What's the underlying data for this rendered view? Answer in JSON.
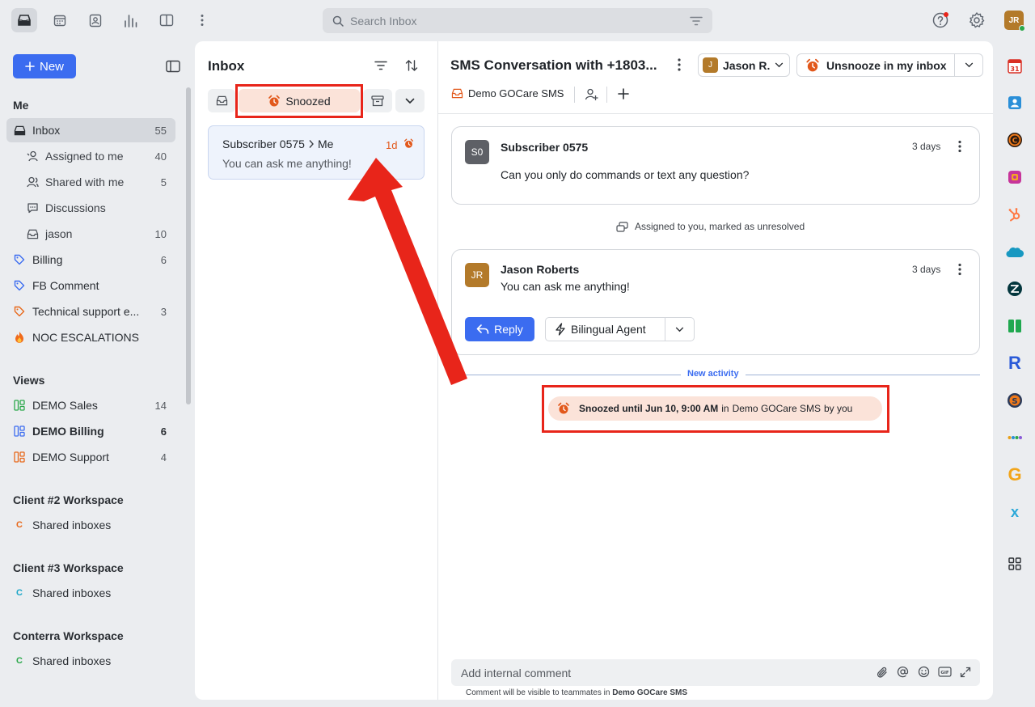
{
  "topbar": {
    "search_placeholder": "Search Inbox",
    "user_initials": "JR",
    "icons": [
      "inbox-icon",
      "calendar-icon",
      "contacts-icon",
      "analytics-icon",
      "split-view-icon",
      "more-icon"
    ]
  },
  "sidebar": {
    "new_label": "New",
    "me_title": "Me",
    "me_items": [
      {
        "label": "Inbox",
        "count": "55"
      },
      {
        "label": "Assigned to me",
        "count": "40"
      },
      {
        "label": "Shared with me",
        "count": "5"
      },
      {
        "label": "Discussions",
        "count": ""
      },
      {
        "label": "jason",
        "count": "10"
      },
      {
        "label": "Billing",
        "count": "6"
      },
      {
        "label": "FB Comment",
        "count": ""
      },
      {
        "label": "Technical support e...",
        "count": "3"
      },
      {
        "label": "NOC ESCALATIONS",
        "count": ""
      }
    ],
    "views_title": "Views",
    "views": [
      {
        "label": "DEMO Sales",
        "count": "14"
      },
      {
        "label": "DEMO Billing",
        "count": "6"
      },
      {
        "label": "DEMO Support",
        "count": "4"
      }
    ],
    "workspaces": [
      {
        "title": "Client #2 Workspace",
        "item": "Shared inboxes",
        "letter": "C",
        "color": "#e8681a"
      },
      {
        "title": "Client #3 Workspace",
        "item": "Shared inboxes",
        "letter": "C",
        "color": "#1aa6c8"
      },
      {
        "title": "Conterra Workspace",
        "item": "Shared inboxes",
        "letter": "C",
        "color": "#2aa84a"
      }
    ]
  },
  "inbox_list": {
    "title": "Inbox",
    "snoozed_label": "Snoozed",
    "item": {
      "sender": "Subscriber 0575",
      "recipient": "Me",
      "time": "1d",
      "preview": "You can ask me anything!"
    }
  },
  "conversation": {
    "title": "SMS Conversation with +1803...",
    "assignee_initial": "J",
    "assignee": "Jason R.",
    "unsnooze_label": "Unsnooze in my inbox",
    "inbox_tag": "Demo GOCare SMS",
    "messages": [
      {
        "initials": "S0",
        "author": "Subscriber 0575",
        "time": "3 days",
        "body": "Can you only do commands or text any question?"
      },
      {
        "initials": "JR",
        "author": "Jason Roberts",
        "time": "3 days",
        "body": "You can ask me anything!"
      }
    ],
    "assigned_event": "Assigned to you, marked as unresolved",
    "reply_label": "Reply",
    "agent_label": "Bilingual Agent",
    "new_activity": "New activity",
    "snooze_event_bold": "Snoozed until Jun 10, 9:00 AM",
    "snooze_event_in": "in",
    "snooze_event_inbox": "Demo GOCare SMS",
    "snooze_event_by": "by you",
    "comment_placeholder": "Add internal comment",
    "comment_note": "Comment will be visible to teammates in",
    "comment_note_inbox": "Demo GOCare SMS"
  },
  "colors": {
    "accent": "#3b6cf0",
    "highlight": "#e8251a",
    "snooze": "#e2581b",
    "snooze_bg": "#fbe3d9"
  }
}
